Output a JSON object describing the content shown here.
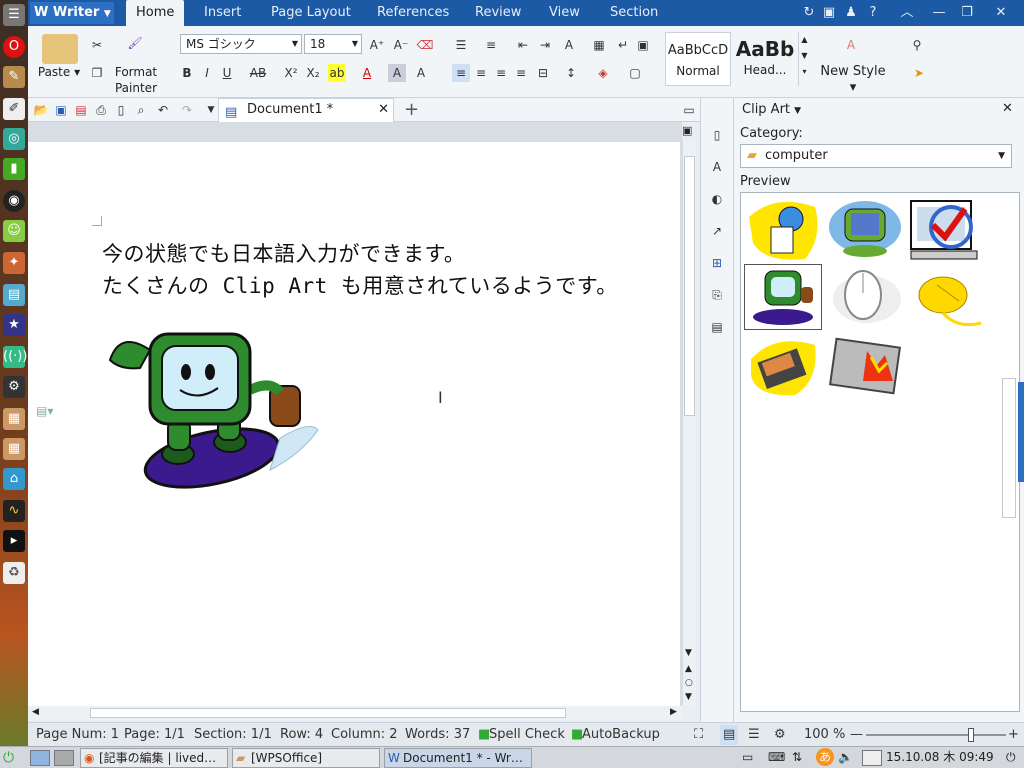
{
  "app": {
    "name": "Writer"
  },
  "menu_tabs": [
    "Home",
    "Insert",
    "Page Layout",
    "References",
    "Review",
    "View",
    "Section"
  ],
  "ribbon": {
    "paste": "Paste",
    "format_painter_1": "Format",
    "format_painter_2": "Painter",
    "font_name": "MS ゴシック",
    "font_size": "18",
    "styles": [
      {
        "preview": "AaBbCcD",
        "label": "Normal"
      },
      {
        "preview": "AaBb",
        "label": "Head..."
      }
    ],
    "new_style": "New Style"
  },
  "document_tab": {
    "title": "Document1 *",
    "add": "+"
  },
  "document": {
    "line1": "今の状態でも日本語入力ができます。",
    "line2": "たくさんの Clip Art も用意されているようです。"
  },
  "clipart_panel": {
    "title": "Clip Art",
    "category_label": "Category:",
    "category_value": "computer",
    "preview_label": "Preview"
  },
  "status": {
    "page_num": "Page Num: 1",
    "page": "Page: 1/1",
    "section": "Section: 1/1",
    "row": "Row: 4",
    "column": "Column: 2",
    "words": "Words: 37",
    "spell": "Spell Check",
    "autobackup": "AutoBackup",
    "zoom": "100 %",
    "zoom_fraction": 0.75
  },
  "taskbar": {
    "items": [
      "[記事の編集 | lived…",
      "[WPSOffice]",
      "Document1 * - Wr…"
    ],
    "clock": "15.10.08 木 09:49"
  },
  "colors": {
    "accent": "#1c5aa6",
    "tab_active": "#f2f5f8"
  }
}
